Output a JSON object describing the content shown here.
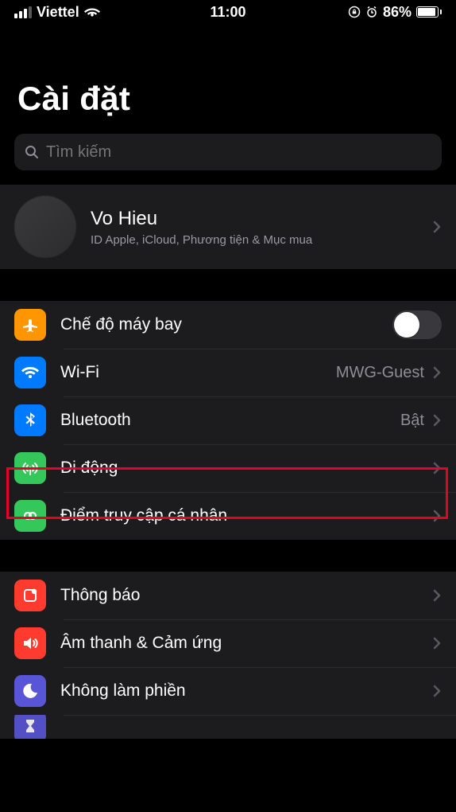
{
  "status_bar": {
    "carrier": "Viettel",
    "time": "11:00",
    "battery_pct": "86%"
  },
  "page_title": "Cài đặt",
  "search": {
    "placeholder": "Tìm kiếm"
  },
  "profile": {
    "name": "Vo Hieu",
    "subtitle": "ID Apple, iCloud, Phương tiện & Mục mua"
  },
  "sections": {
    "network": {
      "airplane": "Chế độ máy bay",
      "wifi_label": "Wi-Fi",
      "wifi_value": "MWG-Guest",
      "bluetooth_label": "Bluetooth",
      "bluetooth_value": "Bật",
      "cellular": "Di động",
      "hotspot": "Điểm truy cập cá nhân"
    },
    "general": {
      "notifications": "Thông báo",
      "sound": "Âm thanh & Cảm ứng",
      "dnd": "Không làm phiền"
    }
  },
  "highlight": {
    "target": "cellular-row"
  }
}
